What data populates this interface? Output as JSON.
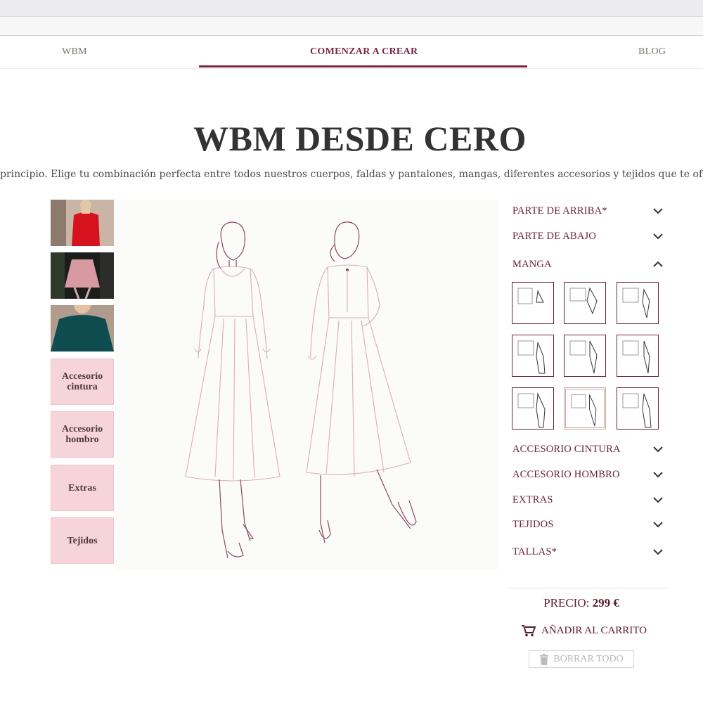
{
  "nav": {
    "items": [
      {
        "label": "WBM"
      },
      {
        "label": "COMENZAR A CREAR"
      },
      {
        "label": "BLOG"
      }
    ]
  },
  "page": {
    "title": "WBM DESDE CERO",
    "subtitle": "principio. Elige tu combinación perfecta entre todos nuestros cuerpos, faldas y pantalones, mangas, diferentes accesorios y tejidos que te ofrecemos, y"
  },
  "thumbs": {
    "accesorio_cintura": "Accesorio cintura",
    "accesorio_hombro": "Accesorio hombro",
    "extras": "Extras",
    "tejidos": "Tejidos"
  },
  "sections": {
    "parte_arriba": "PARTE DE ARRIBA*",
    "parte_abajo": "PARTE DE ABAJO",
    "manga": "MANGA",
    "accesorio_cintura": "ACCESORIO CINTURA",
    "accesorio_hombro": "ACCESORIO HOMBRO",
    "extras": "EXTRAS",
    "tejidos": "TEJIDOS",
    "tallas": "TALLAS*"
  },
  "price": {
    "label": "PRECIO:",
    "value": "299 €"
  },
  "actions": {
    "add_to_cart": "AÑADIR AL CARRITO",
    "clear_all": "BORRAR TODO"
  },
  "colors": {
    "accent": "#7a2840",
    "nav_text": "#6f7a6a",
    "thumb_pink": "#f6d4d9"
  }
}
